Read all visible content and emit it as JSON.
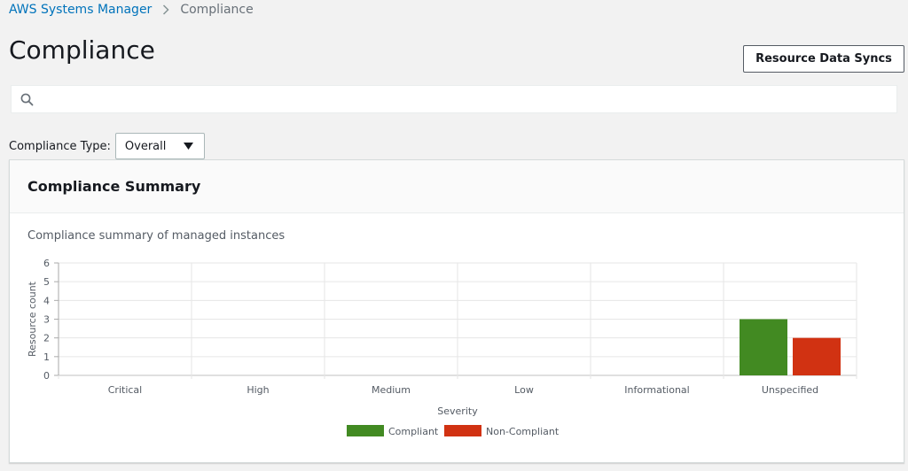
{
  "breadcrumb": {
    "parent": "AWS Systems Manager",
    "current": "Compliance"
  },
  "page_title": "Compliance",
  "actions": {
    "resource_data_syncs": "Resource Data Syncs"
  },
  "search": {
    "placeholder": ""
  },
  "compliance_type": {
    "label": "Compliance Type:",
    "value": "Overall"
  },
  "panel": {
    "title": "Compliance Summary",
    "subtitle": "Compliance summary of managed instances"
  },
  "chart_data": {
    "type": "bar",
    "categories": [
      "Critical",
      "High",
      "Medium",
      "Low",
      "Informational",
      "Unspecified"
    ],
    "series": [
      {
        "name": "Compliant",
        "color": "#428a22",
        "values": [
          0,
          0,
          0,
          0,
          0,
          3
        ]
      },
      {
        "name": "Non-Compliant",
        "color": "#d13212",
        "values": [
          0,
          0,
          0,
          0,
          0,
          2
        ]
      }
    ],
    "xlabel": "Severity",
    "ylabel": "Resource count",
    "ylim": [
      0,
      6
    ],
    "yticks": [
      0,
      1,
      2,
      3,
      4,
      5,
      6
    ],
    "grid": true,
    "legend": "bottom-center"
  }
}
